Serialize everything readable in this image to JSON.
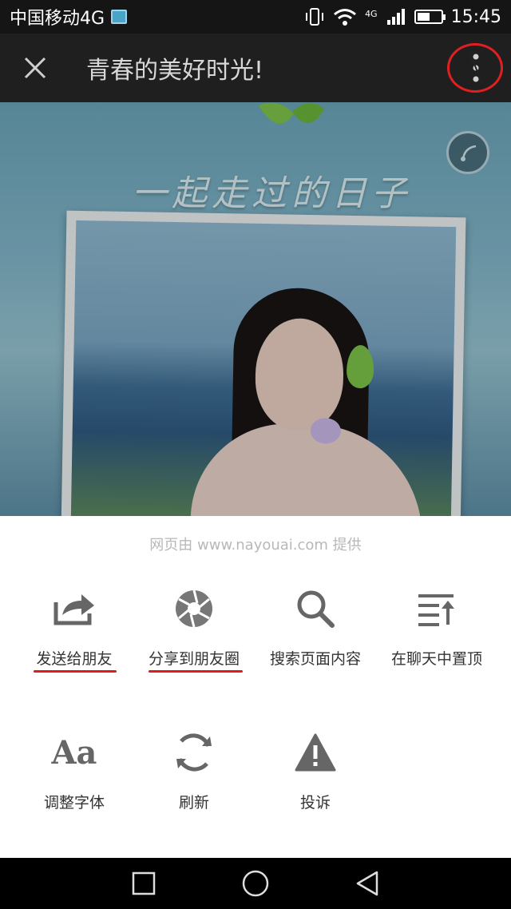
{
  "status_bar": {
    "carrier": "中国移动4G",
    "network_type": "4G",
    "time": "15:45",
    "battery_level": 0.55,
    "icons": [
      "image-notification-icon",
      "vibrate-icon",
      "wifi-icon",
      "signal-icon",
      "battery-icon"
    ]
  },
  "app_bar": {
    "title": "青春的美好时光!",
    "close_icon": "close-icon",
    "more_icon": "more-vertical-icon"
  },
  "webpage": {
    "heading": "一起走过的日子",
    "music_icon": "music-note-icon"
  },
  "share_sheet": {
    "provider_text": "网页由 www.nayouai.com 提供",
    "row1": [
      {
        "label": "发送给朋友",
        "icon": "share-to-friend-icon"
      },
      {
        "label": "分享到朋友圈",
        "icon": "moments-shutter-icon"
      },
      {
        "label": "搜索页面内容",
        "icon": "search-icon"
      },
      {
        "label": "在聊天中置顶",
        "icon": "pin-to-top-icon"
      }
    ],
    "row2": [
      {
        "label": "调整字体",
        "icon": "font-size-icon"
      },
      {
        "label": "刷新",
        "icon": "refresh-icon"
      },
      {
        "label": "投诉",
        "icon": "warning-icon"
      }
    ],
    "highlight_color": "#e21b1b"
  },
  "nav_bar": {
    "icons": [
      "recent-apps-icon",
      "home-icon",
      "back-icon"
    ]
  }
}
